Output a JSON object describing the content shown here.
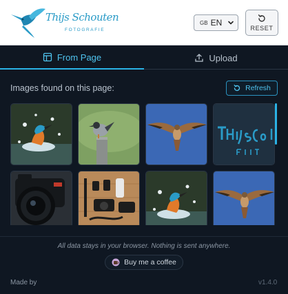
{
  "header": {
    "logo_text": "Thijs Schouten",
    "logo_subtext": "FOTOGRAFIE",
    "language": {
      "flag": "GB",
      "code": "EN"
    },
    "reset_label": "RESET"
  },
  "tabs": [
    {
      "label": "From Page",
      "icon": "layout-icon",
      "active": true
    },
    {
      "label": "Upload",
      "icon": "upload-icon",
      "active": false
    }
  ],
  "main": {
    "images_found_label": "Images found on this page:",
    "refresh_label": "Refresh",
    "thumbnails": [
      {
        "subject": "kingfisher-splash"
      },
      {
        "subject": "bird-on-post"
      },
      {
        "subject": "kestrel-flying"
      },
      {
        "subject": "logo-crop"
      },
      {
        "subject": "camera-lens"
      },
      {
        "subject": "gear-flatlay"
      },
      {
        "subject": "kingfisher-splash"
      },
      {
        "subject": "kestrel-flying"
      }
    ]
  },
  "footer": {
    "privacy_note": "All data stays in your browser. Nothing is sent anywhere.",
    "coffee_label": "Buy me a coffee",
    "made_by": "Made by",
    "version": "v1.4.0"
  },
  "colors": {
    "accent": "#2ab3e6",
    "background": "#0f1722",
    "header_bg": "#ffffff"
  }
}
